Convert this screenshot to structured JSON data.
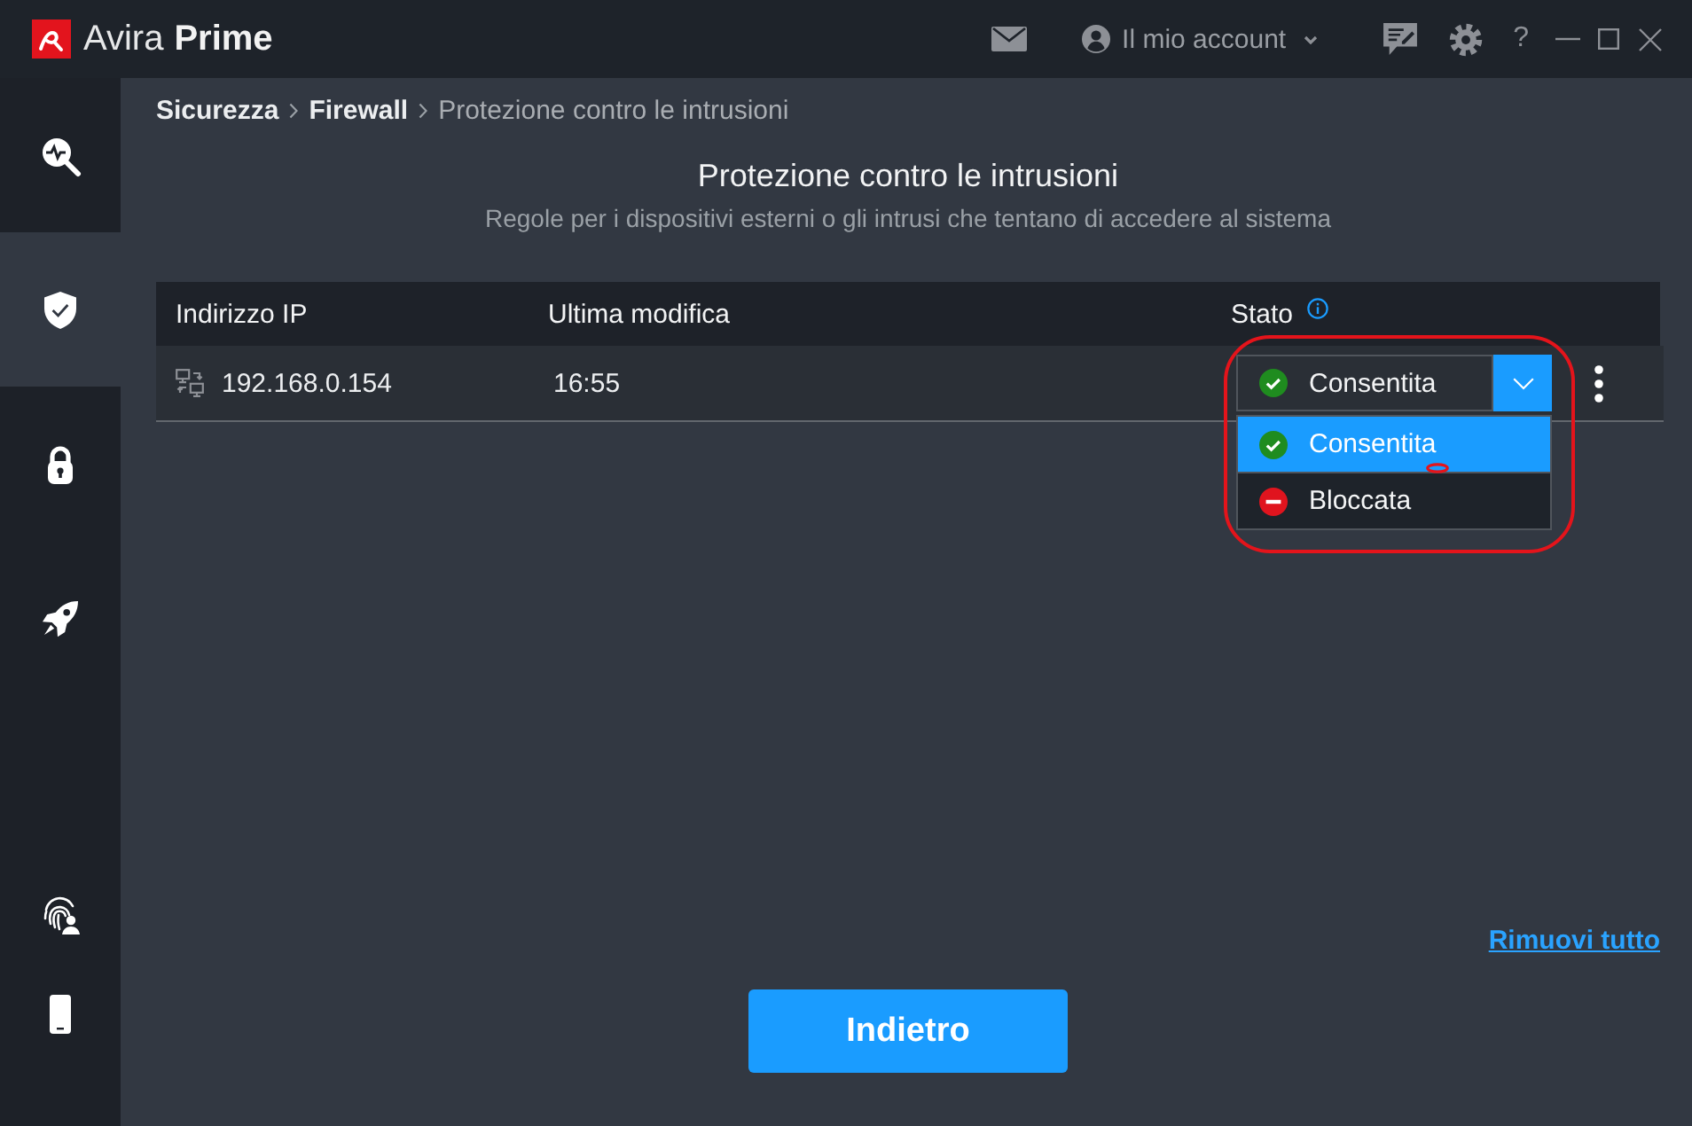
{
  "window": {
    "brand": "Avira",
    "edition": "Prime",
    "account": "Il mio account",
    "help": "?"
  },
  "sidebar": {
    "items": [
      {
        "kind": "scan",
        "selected": false
      },
      {
        "kind": "security",
        "selected": true
      },
      {
        "kind": "privacy",
        "selected": false
      },
      {
        "kind": "performance",
        "selected": false
      }
    ],
    "bottom_items": [
      {
        "kind": "identity",
        "selected": false
      },
      {
        "kind": "mobile",
        "selected": false
      }
    ]
  },
  "breadcrumb": [
    {
      "label": "Sicurezza",
      "current": false
    },
    {
      "label": "Firewall",
      "current": false
    },
    {
      "label": "Protezione contro le intrusioni",
      "current": true
    }
  ],
  "page": {
    "title": "Protezione contro le intrusioni",
    "subtitle": "Regole per i dispositivi esterni o gli intrusi che tentano di accedere al sistema"
  },
  "table": {
    "columns": [
      {
        "label": "Indirizzo IP",
        "info": false
      },
      {
        "label": "Ultima modifica",
        "info": false
      },
      {
        "label": "Stato",
        "info": true
      }
    ],
    "rows": [
      {
        "ip": "192.168.0.154",
        "modified": "16:55",
        "status": {
          "label": "Consentita",
          "kind": "allowed"
        },
        "status_menu": {
          "expanded": true,
          "options": [
            {
              "label": "Consentita",
              "kind": "allowed",
              "selected": true
            },
            {
              "label": "Bloccata",
              "kind": "blocked",
              "selected": false
            }
          ]
        }
      }
    ]
  },
  "footer": {
    "remove_all": "Rimuovi tutto",
    "back_button": "Indietro"
  }
}
